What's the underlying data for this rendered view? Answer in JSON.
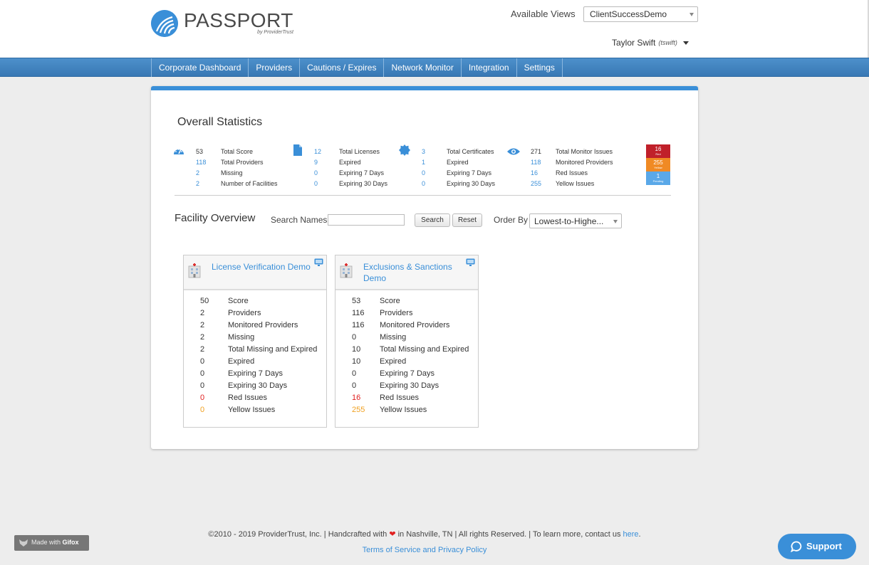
{
  "header": {
    "brand_name": "PASSPORT",
    "brand_sub": "by ProviderTrust",
    "views_label": "Available Views",
    "views_selected": "ClientSuccessDemo",
    "user_name": "Taylor Swift",
    "user_handle": "(tswift)"
  },
  "nav": {
    "items": [
      {
        "label": "Corporate Dashboard"
      },
      {
        "label": "Providers"
      },
      {
        "label": "Cautions / Expires"
      },
      {
        "label": "Network Monitor"
      },
      {
        "label": "Integration"
      },
      {
        "label": "Settings"
      }
    ]
  },
  "overall": {
    "title": "Overall Statistics",
    "score_group": {
      "icon": "gauge-icon",
      "rows": [
        {
          "value": "53",
          "label": "Total Score"
        },
        {
          "value": "118",
          "label": "Total Providers"
        },
        {
          "value": "2",
          "label": "Missing"
        },
        {
          "value": "2",
          "label": "Number of Facilities"
        }
      ]
    },
    "license_group": {
      "icon": "document-icon",
      "rows": [
        {
          "value": "12",
          "label": "Total Licenses"
        },
        {
          "value": "9",
          "label": "Expired"
        },
        {
          "value": "0",
          "label": "Expiring 7 Days"
        },
        {
          "value": "0",
          "label": "Expiring 30 Days"
        }
      ]
    },
    "certificate_group": {
      "icon": "certificate-icon",
      "rows": [
        {
          "value": "3",
          "label": "Total Certificates"
        },
        {
          "value": "1",
          "label": "Expired"
        },
        {
          "value": "0",
          "label": "Expiring 7 Days"
        },
        {
          "value": "0",
          "label": "Expiring 30 Days"
        }
      ]
    },
    "monitor_group": {
      "icon": "eye-icon",
      "rows": [
        {
          "value": "271",
          "label": "Total Monitor Issues"
        },
        {
          "value": "118",
          "label": "Monitored Providers"
        },
        {
          "value": "16",
          "label": "Red Issues"
        },
        {
          "value": "255",
          "label": "Yellow Issues"
        }
      ]
    },
    "badges": [
      {
        "value": "16",
        "label": "Red",
        "color": "#c0202a"
      },
      {
        "value": "255",
        "label": "Yellow",
        "color": "#f08a24"
      },
      {
        "value": "1",
        "label": "Pending",
        "color": "#5aa8e8"
      }
    ]
  },
  "facility": {
    "title": "Facility Overview",
    "search_label": "Search Names",
    "search_value": "",
    "search_button": "Search",
    "reset_button": "Reset",
    "order_label": "Order By",
    "order_selected": "Lowest-to-Highe..."
  },
  "facility_cards": [
    {
      "title": "License Verification Demo",
      "rows": [
        {
          "value": "50",
          "label": "Score"
        },
        {
          "value": "2",
          "label": "Providers"
        },
        {
          "value": "2",
          "label": "Monitored Providers"
        },
        {
          "value": "2",
          "label": "Missing"
        },
        {
          "value": "2",
          "label": "Total Missing and Expired"
        },
        {
          "value": "0",
          "label": "Expired"
        },
        {
          "value": "0",
          "label": "Expiring 7 Days"
        },
        {
          "value": "0",
          "label": "Expiring 30 Days"
        },
        {
          "value": "0",
          "label": "Red Issues"
        },
        {
          "value": "0",
          "label": "Yellow Issues"
        }
      ]
    },
    {
      "title": "Exclusions & Sanctions Demo",
      "rows": [
        {
          "value": "53",
          "label": "Score"
        },
        {
          "value": "116",
          "label": "Providers"
        },
        {
          "value": "116",
          "label": "Monitored Providers"
        },
        {
          "value": "0",
          "label": "Missing"
        },
        {
          "value": "10",
          "label": "Total Missing and Expired"
        },
        {
          "value": "10",
          "label": "Expired"
        },
        {
          "value": "0",
          "label": "Expiring 7 Days"
        },
        {
          "value": "0",
          "label": "Expiring 30 Days"
        },
        {
          "value": "16",
          "label": "Red Issues"
        },
        {
          "value": "255",
          "label": "Yellow Issues"
        }
      ]
    }
  ],
  "footer": {
    "copyright": "©2010 - 2019 ProviderTrust, Inc.",
    "sep1": " | ",
    "handcrafted": "Handcrafted with ",
    "heart": "❤",
    "location": " in Nashville, TN",
    "sep2": " | ",
    "rights": "All rights Reserved.",
    "sep3": " | ",
    "learn_more": "To learn more, contact us ",
    "here_link": "here",
    "period": ".",
    "terms_link": "Terms of Service and Privacy Policy"
  },
  "gifox": {
    "prefix": "Made with ",
    "brand": "Gifox"
  },
  "support": {
    "label": "Support"
  }
}
